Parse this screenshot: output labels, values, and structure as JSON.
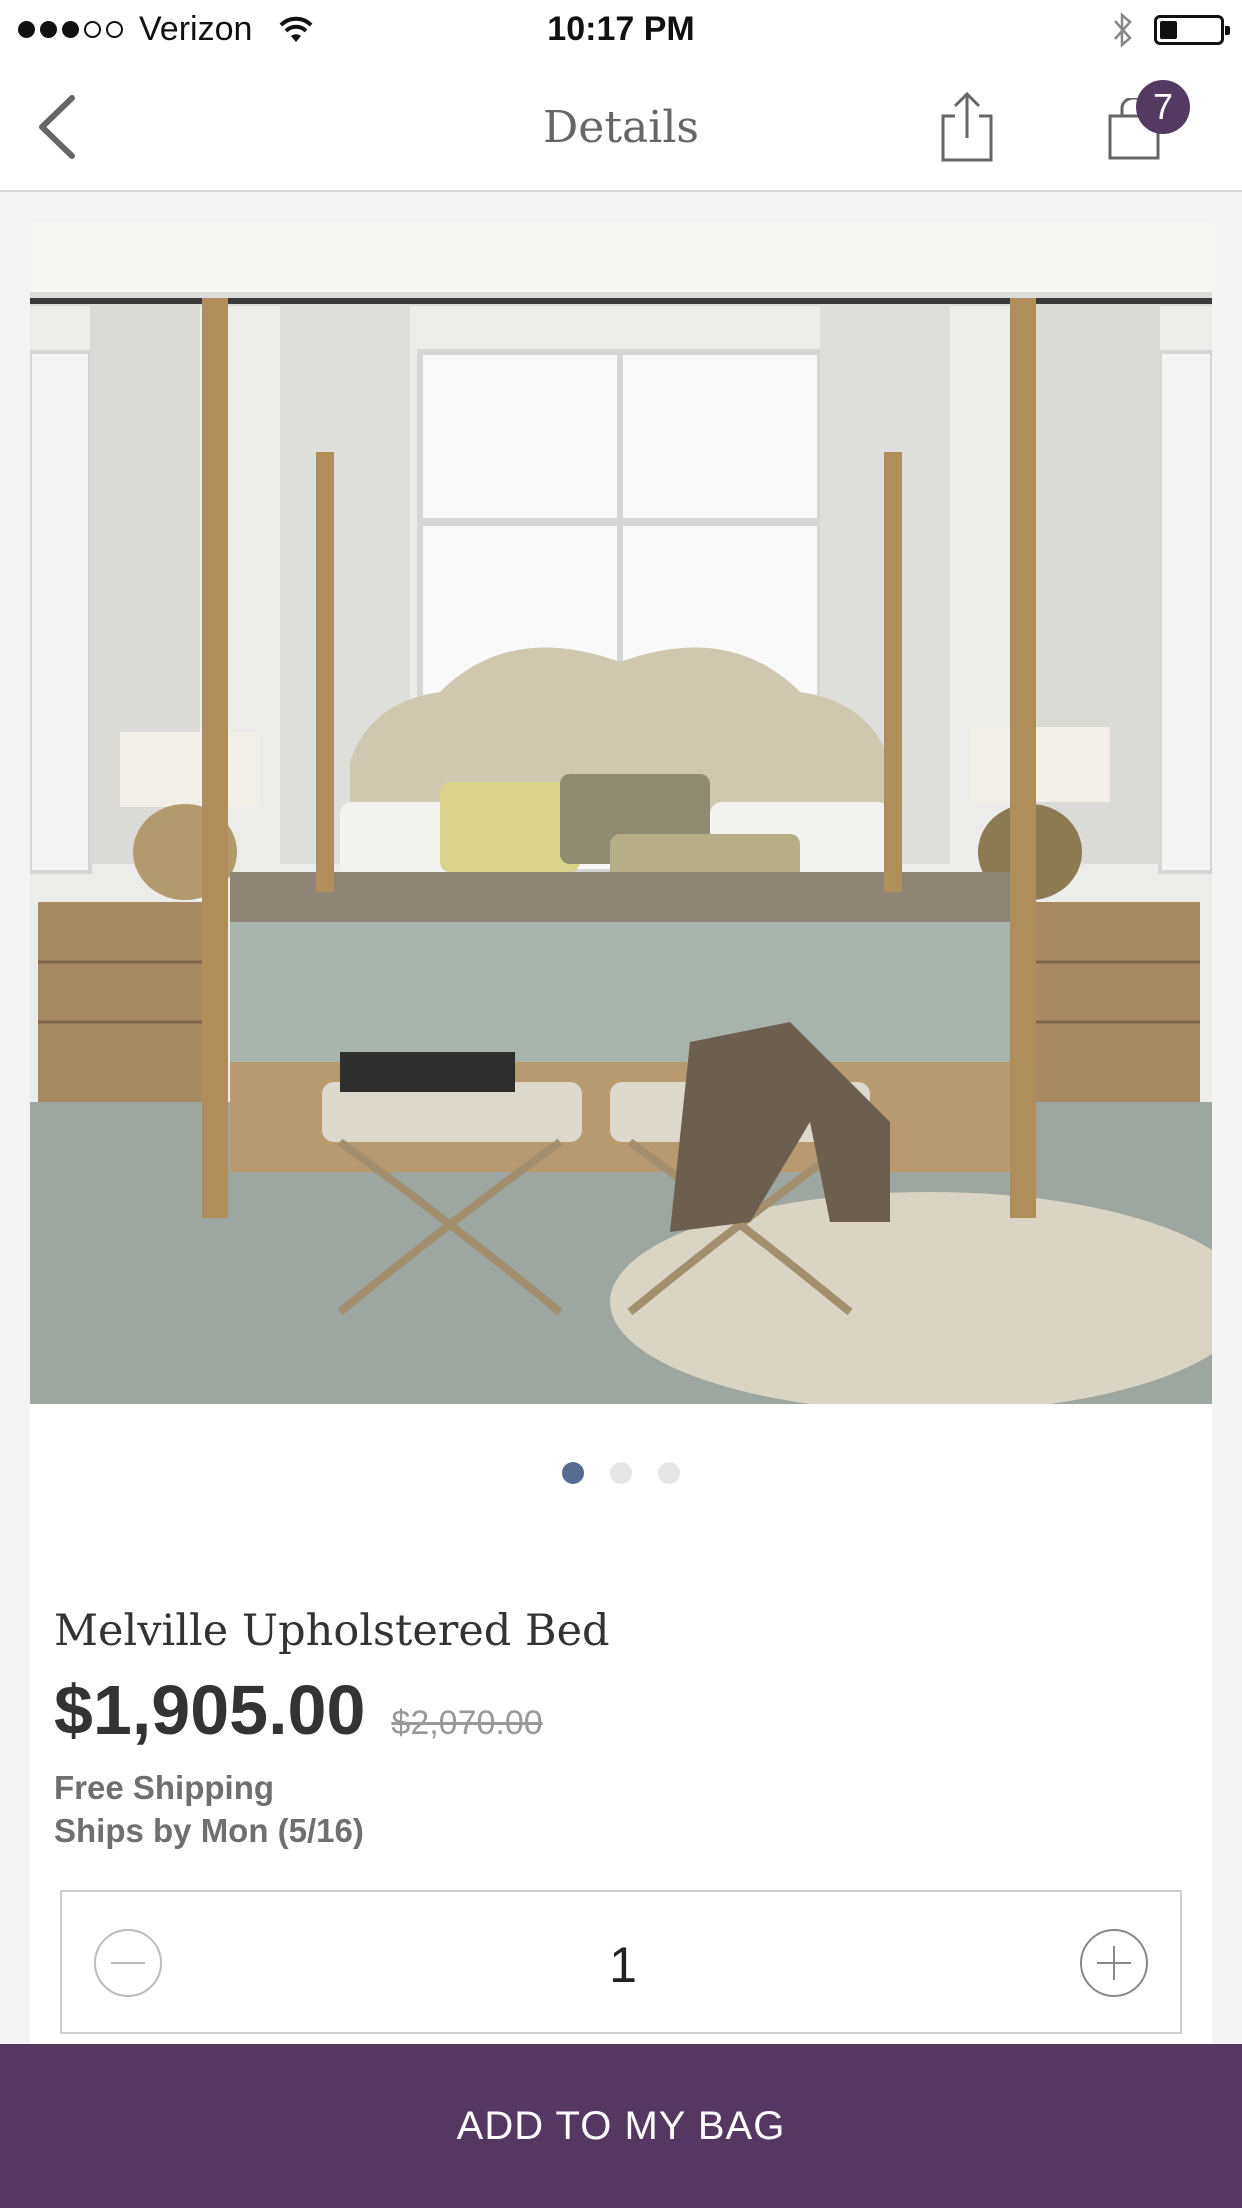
{
  "status_bar": {
    "carrier": "Verizon",
    "time": "10:17 PM",
    "signal_bars_filled": 3,
    "signal_bars_total": 5,
    "battery_level": 0.3
  },
  "nav": {
    "title": "Details",
    "bag_count": "7",
    "back_icon": "chevron-left-icon",
    "share_icon": "share-icon",
    "bag_icon": "shopping-bag-icon"
  },
  "product": {
    "image_description_icon": "product-photo",
    "image_count": 3,
    "current_image": 1,
    "name": "Melville Upholstered Bed",
    "price": "$1,905.00",
    "original_price": "$2,070.00",
    "shipping_line1": "Free Shipping",
    "shipping_line2": "Ships by Mon (5/16)"
  },
  "quantity": {
    "value": "1"
  },
  "cta": {
    "label": "ADD TO MY BAG"
  },
  "colors": {
    "accent": "#553861",
    "badge": "#533a61",
    "pager_active": "#576c91"
  }
}
